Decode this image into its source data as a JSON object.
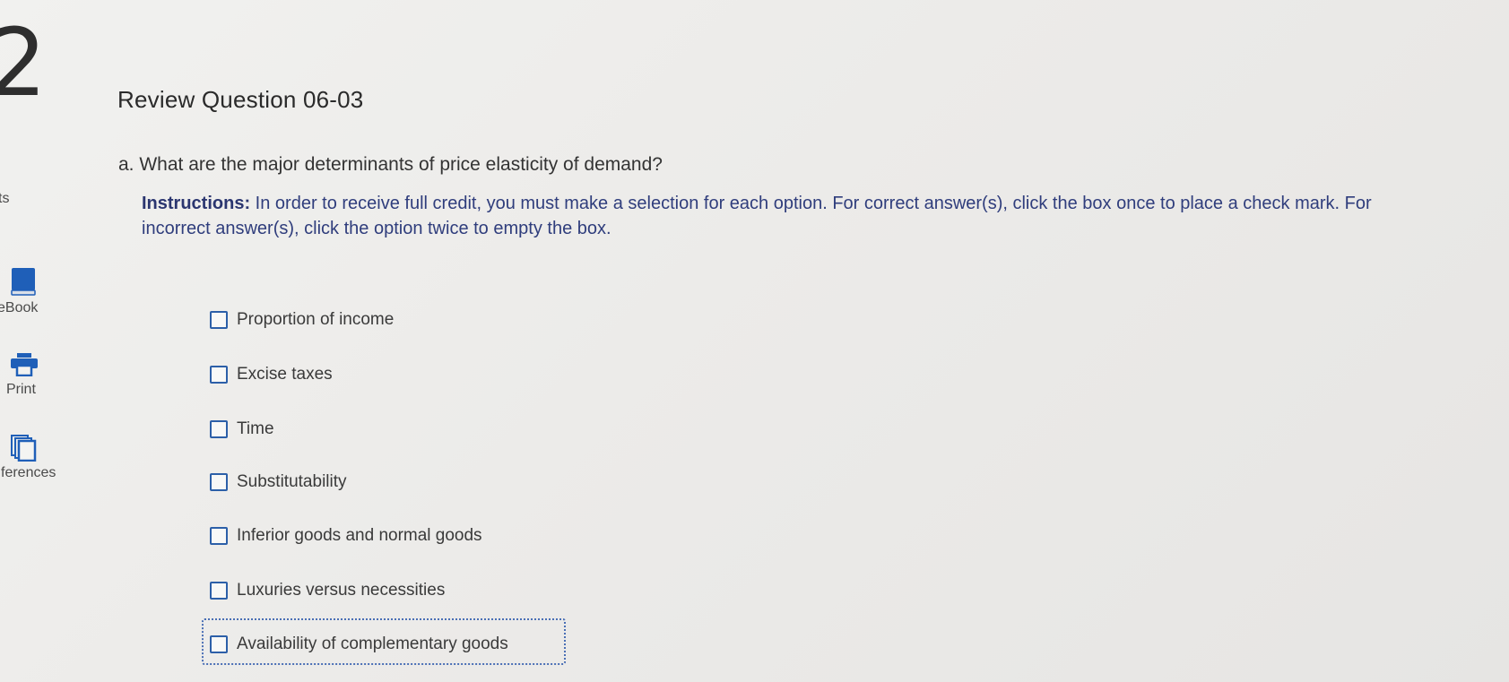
{
  "sidebar": {
    "question_number": "2",
    "fragment_top": "ts",
    "items": [
      {
        "label": "eBook",
        "icon": "book-icon"
      },
      {
        "label": "Print",
        "icon": "printer-icon"
      },
      {
        "label": "ferences",
        "icon": "references-icon"
      }
    ]
  },
  "main": {
    "title": "Review Question 06-03",
    "question": "a. What are the major determinants of price elasticity of demand?",
    "instructions_label": "Instructions:",
    "instructions_text": " In order to receive full credit, you must make a selection for each option. For correct answer(s), click the box once to place a check mark. For incorrect answer(s), click the option twice to empty the box.",
    "options": [
      {
        "label": "Proportion of income",
        "checked": false
      },
      {
        "label": "Excise taxes",
        "checked": false
      },
      {
        "label": "Time",
        "checked": false
      },
      {
        "label": "Substitutability",
        "checked": false
      },
      {
        "label": "Inferior goods and normal goods",
        "checked": false
      },
      {
        "label": "Luxuries versus necessities",
        "checked": false
      },
      {
        "label": "Availability of complementary goods",
        "checked": false
      }
    ]
  },
  "colors": {
    "checkbox_border": "#2c5fa8",
    "instructions_text": "#2f3d7c",
    "icon_blue": "#1f5fb8"
  }
}
